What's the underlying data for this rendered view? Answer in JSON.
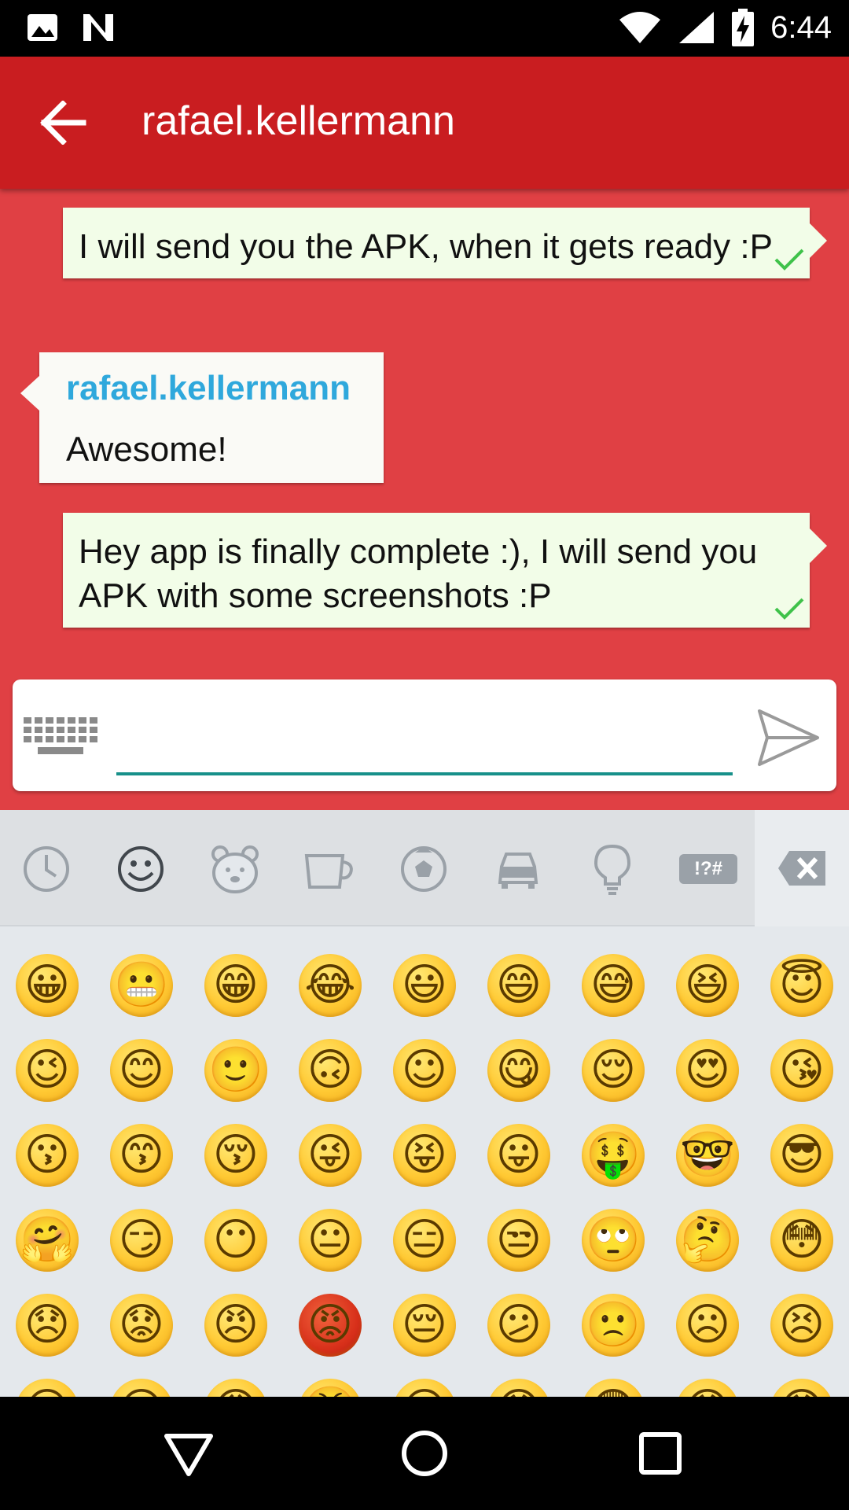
{
  "status_bar": {
    "time": "6:44",
    "icons": [
      "image-icon",
      "n-icon",
      "wifi-icon",
      "signal-icon",
      "battery-charging-icon"
    ]
  },
  "app_bar": {
    "title": "rafael.kellermann",
    "back_icon": "arrow-left-icon",
    "color": "#c91d20"
  },
  "messages": [
    {
      "direction": "outgoing",
      "text": "I will send you the APK, when it gets ready :P",
      "status": "sent-check"
    },
    {
      "direction": "incoming",
      "sender": "rafael.kellermann",
      "text": "Awesome!"
    },
    {
      "direction": "outgoing",
      "text": "Hey app is finally complete :), I will send you APK with some screenshots :P",
      "status": "sent-check"
    }
  ],
  "composer": {
    "value": "",
    "placeholder": "",
    "keyboard_icon": "keyboard-icon",
    "send_icon": "send-icon"
  },
  "emoji_keyboard": {
    "categories": [
      "recent-icon",
      "smileys-icon",
      "animals-icon",
      "food-icon",
      "sports-icon",
      "travel-icon",
      "objects-icon",
      "symbols-icon"
    ],
    "selected_category": "smileys-icon",
    "symbols_label": "!?#",
    "backspace_icon": "backspace-icon",
    "rows": [
      [
        "😀",
        "😬",
        "😁",
        "😂",
        "😃",
        "😄",
        "😅",
        "😆",
        "😇"
      ],
      [
        "😉",
        "😊",
        "🙂",
        "🙃",
        "☺",
        "😋",
        "😌",
        "😍",
        "😘"
      ],
      [
        "😗",
        "😙",
        "😚",
        "😜",
        "😝",
        "😛",
        "🤑",
        "🤓",
        "😎"
      ],
      [
        "🤗",
        "😏",
        "😶",
        "😐",
        "😑",
        "😒",
        "🙄",
        "🤔",
        "😳"
      ],
      [
        "😞",
        "😟",
        "😠",
        "😡",
        "😔",
        "😕",
        "🙁",
        "☹",
        "😣"
      ],
      [
        "😖",
        "😫",
        "😩",
        "😤",
        "😮",
        "😱",
        "😨",
        "😰",
        "😯"
      ]
    ]
  },
  "nav_bar": {
    "buttons": [
      "back-triangle-icon",
      "home-circle-icon",
      "recents-square-icon"
    ]
  }
}
